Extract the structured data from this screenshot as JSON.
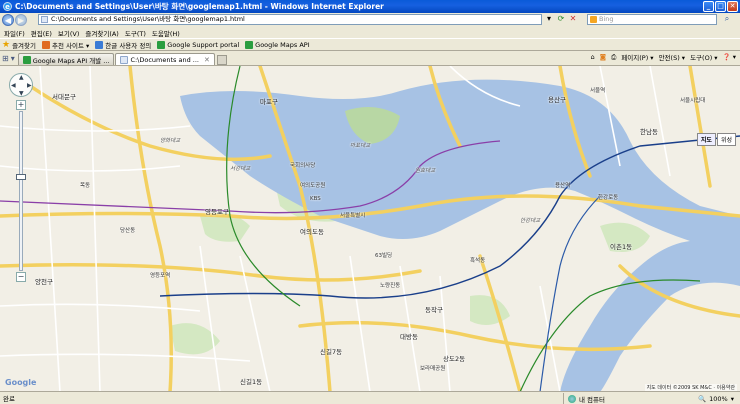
{
  "window": {
    "title": "C:\\Documents and Settings\\User\\바탕 화면\\googlemap1.html - Windows Internet Explorer",
    "minimize": "_",
    "maximize": "□",
    "close": "✕"
  },
  "address_bar": {
    "url": "C:\\Documents and Settings\\User\\바탕 화면\\googlemap1.html",
    "search_placeholder": "Bing",
    "back": "◀",
    "forward": "▶"
  },
  "menu": [
    "파일(F)",
    "편집(E)",
    "보기(V)",
    "즐겨찾기(A)",
    "도구(T)",
    "도움말(H)"
  ],
  "favorites_bar": {
    "favorites_label": "즐겨찾기",
    "items": [
      {
        "label": "추천 사이트 ▾",
        "color": "#e06b1f"
      },
      {
        "label": "한글 사용자 정의",
        "color": "#3a7bd5"
      },
      {
        "label": "Google Support portal",
        "color": "#2a9d3f"
      },
      {
        "label": "Google Maps API",
        "color": "#2a9d3f"
      }
    ]
  },
  "tabs": [
    {
      "label": "Google Maps API 개발 ...",
      "active": false
    },
    {
      "label": "C:\\Documents and ...",
      "active": true
    }
  ],
  "command_bar": [
    "페이지(P) ▾",
    "안전(S) ▾",
    "도구(O) ▾",
    "❓ ▾"
  ],
  "map": {
    "map_type_buttons": [
      {
        "label": "지도",
        "selected": true
      },
      {
        "label": "위성",
        "selected": false
      }
    ],
    "zoom_in": "+",
    "zoom_out": "−",
    "logo": "Google",
    "copyright": "지도 데이터 ©2009 SK M&C · 이용약관",
    "labels": [
      {
        "text": "서빙고동",
        "pos": "a"
      },
      {
        "text": "용산구",
        "pos": "b"
      },
      {
        "text": "서대문구",
        "pos": "c"
      },
      {
        "text": "마포구",
        "pos": "d"
      },
      {
        "text": "영등포구",
        "pos": "e"
      },
      {
        "text": "여의도동",
        "pos": "f"
      },
      {
        "text": "서울특별시",
        "pos": "g"
      },
      {
        "text": "한강로동",
        "pos": "h"
      },
      {
        "text": "이촌1동",
        "pos": "i"
      },
      {
        "text": "동작구",
        "pos": "j"
      },
      {
        "text": "흑석동",
        "pos": "k"
      },
      {
        "text": "신길7동",
        "pos": "l"
      },
      {
        "text": "상도2동",
        "pos": "m"
      },
      {
        "text": "양천구",
        "pos": "n"
      },
      {
        "text": "목동",
        "pos": "o"
      },
      {
        "text": "당산동",
        "pos": "p"
      },
      {
        "text": "신길1동",
        "pos": "q"
      },
      {
        "text": "노량진동",
        "pos": "r"
      },
      {
        "text": "서강대교",
        "pos": "s"
      },
      {
        "text": "마포대교",
        "pos": "t"
      },
      {
        "text": "원효대교",
        "pos": "u"
      },
      {
        "text": "한강대교",
        "pos": "v"
      },
      {
        "text": "양화대교",
        "pos": "w"
      },
      {
        "text": "여의도공원",
        "pos": "x"
      },
      {
        "text": "KBS",
        "pos": "y"
      },
      {
        "text": "63빌딩",
        "pos": "z"
      },
      {
        "text": "용산역",
        "pos": "aa"
      },
      {
        "text": "서울역",
        "pos": "ab"
      },
      {
        "text": "서울시립대",
        "pos": "ac"
      },
      {
        "text": "국회의사당",
        "pos": "ad"
      },
      {
        "text": "영등포역",
        "pos": "ae"
      },
      {
        "text": "대방동",
        "pos": "af"
      },
      {
        "text": "보라매공원",
        "pos": "ag"
      },
      {
        "text": "한남동",
        "pos": "ah"
      }
    ]
  },
  "status_bar": {
    "left": "완료",
    "zone": "내 컴퓨터",
    "zoom": "100%"
  }
}
